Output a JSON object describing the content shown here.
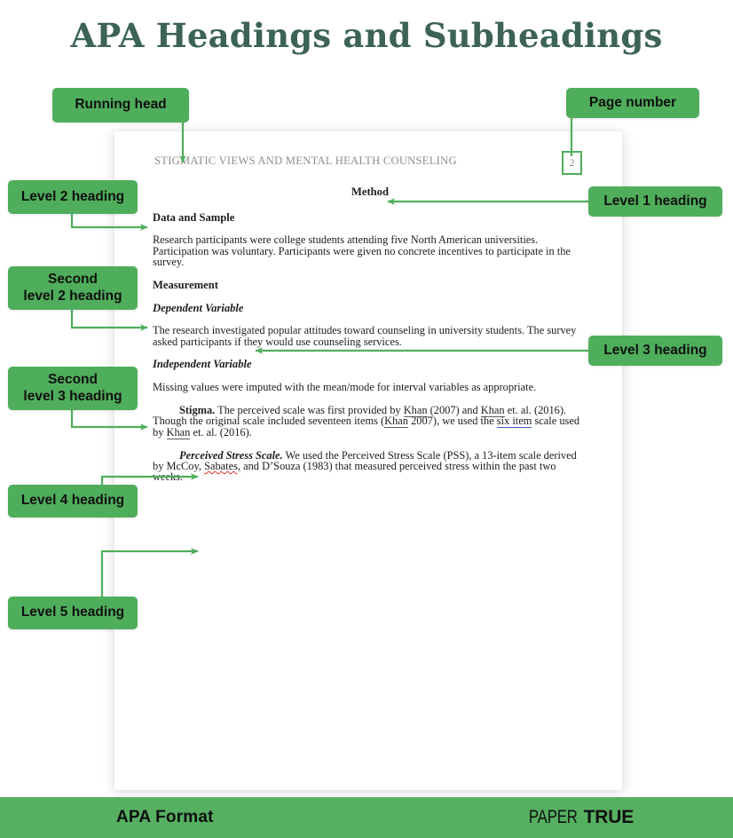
{
  "title": "APA Headings and Subheadings",
  "theme": {
    "accent_green": "#4fae5b",
    "footer_green": "#55b061",
    "title_green": "#3c6353",
    "running_head_gray": "#8d8d8d",
    "spelling_error_red": "#e02b2b",
    "link_blue": "#3b5ec9"
  },
  "document": {
    "running_head": "STIGMATIC VIEWS AND MENTAL HEALTH COUNSELING",
    "page_number": "2",
    "level1_heading": "Method",
    "level2_heading_first": "Data and Sample",
    "paragraph_1": "Research participants were college students attending five North American universities. Participation was voluntary. Participants were given no concrete incentives to participate in the survey.",
    "level2_heading_second": "Measurement",
    "level3_heading_first": "Dependent Variable",
    "paragraph_2": "The research investigated popular attitudes toward counseling in university students. The survey asked participants if they would use counseling services.",
    "level3_heading_second": "Independent Variable",
    "paragraph_3": "Missing values were imputed with the mean/mode for interval variables as appropriate.",
    "level4_heading": "Stigma.",
    "paragraph_4_a": " The perceived scale was first provided by ",
    "paragraph_4_khan1": "Khan",
    "paragraph_4_b": " (2007) and ",
    "paragraph_4_khan2": "Khan",
    "paragraph_4_c": " et. al. (2016). Though the original scale included seventeen items (",
    "paragraph_4_khan3": "Khan",
    "paragraph_4_d": " 2007), we used the ",
    "paragraph_4_link": "six item",
    "paragraph_4_e": " scale used by ",
    "paragraph_4_khan4": "Khan",
    "paragraph_4_f": " et. al. (2016).",
    "level5_heading": "Perceived Stress Scale.",
    "paragraph_5_a": " We used the Perceived Stress Scale (PSS), a 13-item scale derived by McCoy, ",
    "paragraph_5_err": "Sabates,",
    "paragraph_5_b": " and D’Souza (1983) that measured perceived stress within the past two weeks."
  },
  "callouts": {
    "running_head": "Running head",
    "page_number": "Page number",
    "level1": "Level 1 heading",
    "level2": "Level 2 heading",
    "level2_second": "Second\nlevel 2 heading",
    "level3": "Level 3 heading",
    "level3_second": "Second\nlevel 3 heading",
    "level4": "Level 4 heading",
    "level5": "Level 5 heading"
  },
  "footer": {
    "label": "APA Format",
    "logo_light": "PAPER",
    "logo_bold": "TRUE"
  }
}
